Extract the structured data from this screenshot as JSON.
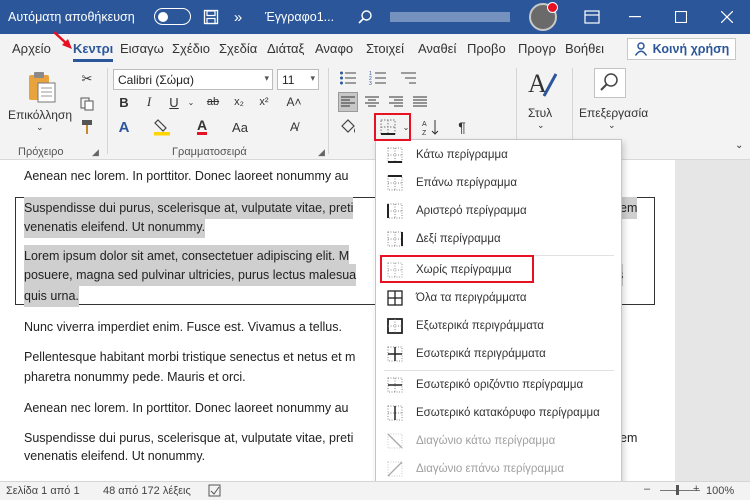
{
  "titlebar": {
    "autosave_label": "Αυτόματη αποθήκευση",
    "doc_title": "Έγγραφο1...",
    "color": "#2b579a",
    "icons": [
      "save-icon",
      "more-chevron-icon",
      "search-icon",
      "minimize-icon",
      "maximize-icon",
      "close-icon"
    ]
  },
  "tabs": [
    {
      "label": "Αρχείο"
    },
    {
      "label": "Κεντρι",
      "active": true
    },
    {
      "label": "Εισαγω"
    },
    {
      "label": "Σχέδιο"
    },
    {
      "label": "Σχεδία"
    },
    {
      "label": "Διάταξ"
    },
    {
      "label": "Αναφο"
    },
    {
      "label": "Στοιχεί"
    },
    {
      "label": "Αναθεί"
    },
    {
      "label": "Προβο"
    },
    {
      "label": "Προγρ"
    },
    {
      "label": "Βοήθει"
    }
  ],
  "share_label": "Κοινή χρήση",
  "ribbon": {
    "paste_label": "Επικόλληση",
    "clipboard_label": "Πρόχειρο",
    "font_name": "Calibri (Σώμα)",
    "font_size": "11",
    "font_group_label": "Γραμματοσειρά",
    "styles_label": "Στυλ",
    "editing_label": "Επεξεργασία"
  },
  "document": {
    "p1": "Aenean nec lorem. In porttitor. Donec laoreet nonummy au",
    "p2_line1": "Suspendisse dui purus, scelerisque at, vulputate vitae, preti",
    "p2_line1_end": "em",
    "p2_line2": "venenatis eleifend. Ut nonummy.",
    "p3_line1": "Lorem ipsum dolor sit amet, consectetuer adipiscing elit. M",
    "p3_line2": "posuere, magna sed pulvinar ultricies, purus lectus malesua",
    "p3_line2_end": "s",
    "p3_line3": "quis urna.",
    "p4": "Nunc viverra imperdiet enim. Fusce est. Vivamus a tellus.",
    "p5_line1": "Pellentesque habitant morbi tristique senectus et netus et m",
    "p5_line2": "pharetra nonummy pede. Mauris et orci.",
    "p6": "Aenean nec lorem. In porttitor. Donec laoreet nonummy au",
    "p7_line1": "Suspendisse dui purus, scelerisque at, vulputate vitae, preti",
    "p7_line1_end": "em",
    "p7_line2": "venenatis eleifend. Ut nonummy."
  },
  "borders_menu": {
    "items": [
      {
        "label": "Κάτω περίγραμμα",
        "icon": "bottom-border-icon",
        "disabled": false
      },
      {
        "label": "Επάνω περίγραμμα",
        "icon": "top-border-icon",
        "disabled": false
      },
      {
        "label": "Αριστερό περίγραμμα",
        "icon": "left-border-icon",
        "disabled": false
      },
      {
        "label": "Δεξί περίγραμμα",
        "icon": "right-border-icon",
        "disabled": false
      },
      {
        "label": "Χωρίς περίγραμμα",
        "icon": "no-border-icon",
        "disabled": false
      },
      {
        "label": "Όλα τα περιγράμματα",
        "icon": "all-borders-icon",
        "disabled": false
      },
      {
        "label": "Εξωτερικά περιγράμματα",
        "icon": "outside-borders-icon",
        "disabled": false
      },
      {
        "label": "Εσωτερικά περιγράμματα",
        "icon": "inside-borders-icon",
        "disabled": false
      },
      {
        "label": "Εσωτερικό οριζόντιο περίγραμμα",
        "icon": "inside-horizontal-border-icon",
        "disabled": false
      },
      {
        "label": "Εσωτερικό κατακόρυφο περίγραμμα",
        "icon": "inside-vertical-border-icon",
        "disabled": false
      },
      {
        "label": "Διαγώνιο κάτω περίγραμμα",
        "icon": "diagonal-down-border-icon",
        "disabled": true
      },
      {
        "label": "Διαγώνιο επάνω περίγραμμα",
        "icon": "diagonal-up-border-icon",
        "disabled": true
      }
    ]
  },
  "statusbar": {
    "page": "Σελίδα 1 από 1",
    "words": "48 από 172 λέξεις",
    "zoom": "100%"
  }
}
